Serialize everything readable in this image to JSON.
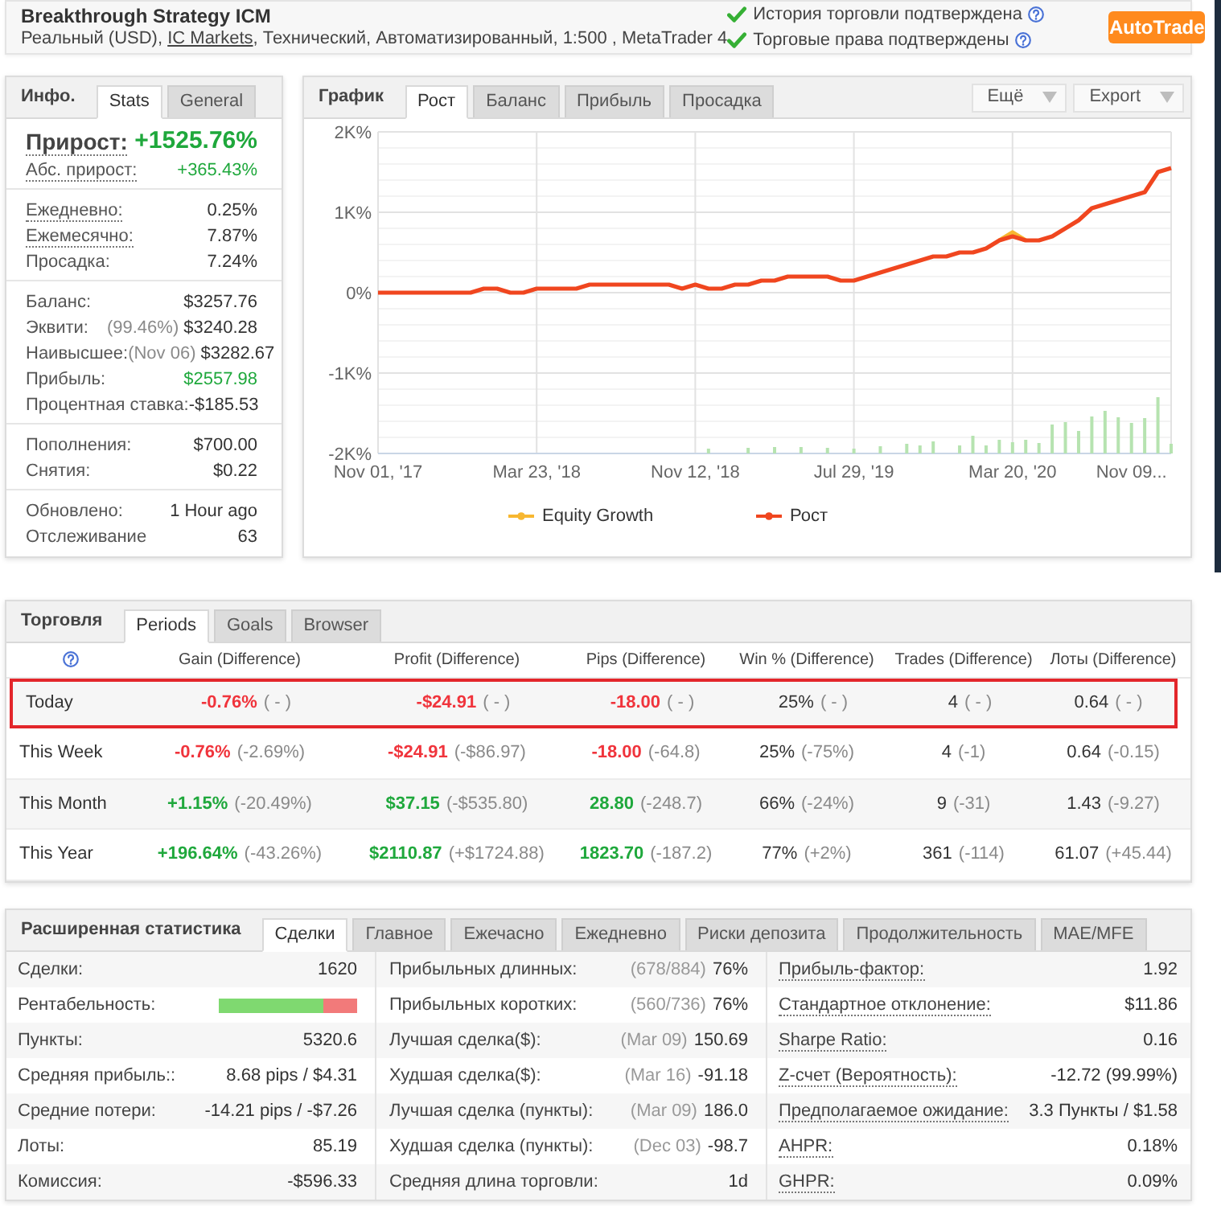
{
  "header": {
    "title": "Breakthrough Strategy ICM",
    "subtitle": [
      {
        "kind": "text",
        "text": "Реальный (USD), "
      },
      {
        "kind": "link",
        "text": "IC Markets"
      },
      {
        "kind": "text",
        "text": ", Технический, Автоматизированный, 1:500 , MetaTrader 4"
      }
    ],
    "verifications": [
      {
        "text": "История торговли подтверждена",
        "verified": true
      },
      {
        "text": "Торговые права подтверждены",
        "verified": true
      }
    ],
    "action_button": "AutoTrade"
  },
  "info_panel": {
    "title": "Инфо.",
    "tabs": [
      {
        "label": "Stats",
        "selected": true
      },
      {
        "label": "General",
        "selected": false
      }
    ],
    "groups": [
      [
        {
          "kind": "headline",
          "label": "Прирост:",
          "value": "+1525.76%",
          "color": "#1fa83c",
          "tooltip": true
        },
        {
          "kind": "text",
          "label": "Абс. прирост:",
          "value": "+365.43%",
          "color": "#1fa83c",
          "tooltip": true
        }
      ],
      [
        {
          "kind": "text",
          "label": "Ежедневно:",
          "value": "0.25%",
          "color": "#333333",
          "tooltip": true
        },
        {
          "kind": "text",
          "label": "Ежемесячно:",
          "value": "7.87%",
          "color": "#333333",
          "tooltip": true
        },
        {
          "kind": "text",
          "label": "Просадка:",
          "value": "7.24%",
          "color": "#333333",
          "tooltip": false
        }
      ],
      [
        {
          "kind": "text",
          "label": "Баланс:",
          "value": "$3257.76",
          "color": "#333333",
          "tooltip": false
        },
        {
          "kind": "text",
          "label": "Эквити:",
          "note": "(99.46%)",
          "value": "$3240.28",
          "color": "#333333",
          "tooltip": false
        },
        {
          "kind": "text",
          "label": "Наивысшее:",
          "note": "(Nov 06)",
          "value": "$3282.67",
          "color": "#333333",
          "tooltip": false
        },
        {
          "kind": "text",
          "label": "Прибыль:",
          "value": "$2557.98",
          "color": "#1fa83c",
          "tooltip": false
        },
        {
          "kind": "text",
          "label": "Процентная ставка:",
          "value": "-$185.53",
          "color": "#333333",
          "tooltip": false
        }
      ],
      [
        {
          "kind": "text",
          "label": "Пополнения:",
          "value": "$700.00",
          "color": "#333333",
          "tooltip": false
        },
        {
          "kind": "text",
          "label": "Снятия:",
          "value": "$0.22",
          "color": "#333333",
          "tooltip": false
        }
      ],
      [
        {
          "kind": "text",
          "label": "Обновлено:",
          "value": "1 Hour ago",
          "color": "#333333",
          "tooltip": false
        },
        {
          "kind": "text",
          "label": "Отслеживание",
          "value": "63",
          "color": "#333333",
          "tooltip": false
        }
      ]
    ]
  },
  "chart_panel": {
    "title": "График",
    "tabs": [
      {
        "label": "Рост",
        "selected": true
      },
      {
        "label": "Баланс",
        "selected": false
      },
      {
        "label": "Прибыль",
        "selected": false
      },
      {
        "label": "Просадка",
        "selected": false
      }
    ],
    "menus": [
      {
        "label": "Ещё"
      },
      {
        "label": "Export"
      }
    ],
    "chart_data": {
      "type": "line",
      "grid": true,
      "categories": [
        "Nov 01, '17",
        null,
        null,
        null,
        null,
        null,
        null,
        null,
        null,
        null,
        null,
        null,
        "Mar 23, '18",
        null,
        null,
        null,
        null,
        null,
        null,
        null,
        null,
        null,
        null,
        null,
        "Nov 12, '18",
        null,
        null,
        null,
        null,
        null,
        null,
        null,
        null,
        null,
        null,
        null,
        "Jul 29, '19",
        null,
        null,
        null,
        null,
        null,
        null,
        null,
        null,
        null,
        null,
        null,
        "Mar 20, '20",
        null,
        null,
        null,
        null,
        null,
        null,
        null,
        null,
        "Nov 09...",
        null,
        null,
        null
      ],
      "ylim": [
        -2000,
        2000
      ],
      "yticks": [
        {
          "value": 2000,
          "label": "2K%"
        },
        {
          "value": 1000,
          "label": "1K%"
        },
        {
          "value": 0,
          "label": "0%"
        },
        {
          "value": -1000,
          "label": "-1K%"
        },
        {
          "value": -2000,
          "label": "-2K%"
        }
      ],
      "series": [
        {
          "name": "Equity Growth",
          "color": "#f7b731",
          "values": [
            null,
            null,
            null,
            null,
            null,
            null,
            null,
            null,
            null,
            null,
            null,
            null,
            null,
            null,
            null,
            null,
            null,
            null,
            null,
            null,
            null,
            null,
            null,
            null,
            null,
            null,
            null,
            null,
            null,
            null,
            null,
            null,
            null,
            null,
            null,
            null,
            null,
            null,
            null,
            null,
            null,
            null,
            null,
            null,
            null,
            null,
            null,
            650,
            750,
            650,
            null,
            null,
            null,
            null,
            null,
            null,
            null,
            null,
            null,
            null,
            null
          ]
        },
        {
          "name": "Рост",
          "color": "#f0461f",
          "values": [
            0,
            0,
            0,
            0,
            0,
            0,
            0,
            0,
            50,
            50,
            0,
            0,
            50,
            50,
            50,
            50,
            100,
            100,
            100,
            100,
            100,
            100,
            100,
            50,
            100,
            50,
            50,
            100,
            100,
            150,
            150,
            200,
            200,
            200,
            200,
            150,
            150,
            200,
            250,
            300,
            350,
            400,
            450,
            450,
            500,
            500,
            550,
            650,
            700,
            650,
            650,
            700,
            800,
            900,
            1050,
            1100,
            1150,
            1200,
            1250,
            1500,
            1550
          ]
        }
      ]
    }
  },
  "trading_panel": {
    "title": "Торговля",
    "tabs": [
      {
        "label": "Periods",
        "selected": true
      },
      {
        "label": "Goals",
        "selected": false
      },
      {
        "label": "Browser",
        "selected": false
      }
    ],
    "columns": [
      "Gain (Difference)",
      "Profit (Difference)",
      "Pips (Difference)",
      "Win % (Difference)",
      "Trades (Difference)",
      "Лоты (Difference)"
    ],
    "rows": [
      {
        "label": "Today",
        "highlighted": true,
        "cells": [
          {
            "value": "-0.76%",
            "diff": "( - )",
            "color": "#f0343c"
          },
          {
            "value": "-$24.91",
            "diff": "( - )",
            "color": "#f0343c"
          },
          {
            "value": "-18.00",
            "diff": "( - )",
            "color": "#f0343c"
          },
          {
            "value": "25%",
            "diff": "( - )",
            "color": "#333333"
          },
          {
            "value": "4",
            "diff": "( - )",
            "color": "#333333"
          },
          {
            "value": "0.64",
            "diff": "( - )",
            "color": "#333333"
          }
        ]
      },
      {
        "label": "This Week",
        "highlighted": false,
        "cells": [
          {
            "value": "-0.76%",
            "diff": "(-2.69%)",
            "color": "#f0343c"
          },
          {
            "value": "-$24.91",
            "diff": "(-$86.97)",
            "color": "#f0343c"
          },
          {
            "value": "-18.00",
            "diff": "(-64.8)",
            "color": "#f0343c"
          },
          {
            "value": "25%",
            "diff": "(-75%)",
            "color": "#333333"
          },
          {
            "value": "4",
            "diff": "(-1)",
            "color": "#333333"
          },
          {
            "value": "0.64",
            "diff": "(-0.15)",
            "color": "#333333"
          }
        ]
      },
      {
        "label": "This Month",
        "highlighted": false,
        "cells": [
          {
            "value": "+1.15%",
            "diff": "(-20.49%)",
            "color": "#1fa83c"
          },
          {
            "value": "$37.15",
            "diff": "(-$535.80)",
            "color": "#1fa83c"
          },
          {
            "value": "28.80",
            "diff": "(-248.7)",
            "color": "#1fa83c"
          },
          {
            "value": "66%",
            "diff": "(-24%)",
            "color": "#333333"
          },
          {
            "value": "9",
            "diff": "(-31)",
            "color": "#333333"
          },
          {
            "value": "1.43",
            "diff": "(-9.27)",
            "color": "#333333"
          }
        ]
      },
      {
        "label": "This Year",
        "highlighted": false,
        "cells": [
          {
            "value": "+196.64%",
            "diff": "(-43.26%)",
            "color": "#1fa83c"
          },
          {
            "value": "$2110.87",
            "diff": "(+$1724.88)",
            "color": "#1fa83c"
          },
          {
            "value": "1823.70",
            "diff": "(-187.2)",
            "color": "#1fa83c"
          },
          {
            "value": "77%",
            "diff": "(+2%)",
            "color": "#333333"
          },
          {
            "value": "361",
            "diff": "(-114)",
            "color": "#333333"
          },
          {
            "value": "61.07",
            "diff": "(+45.44)",
            "color": "#333333"
          }
        ]
      }
    ]
  },
  "extended_stats": {
    "title": "Расширенная статистика",
    "tabs": [
      {
        "label": "Сделки",
        "selected": true
      },
      {
        "label": "Главное",
        "selected": false
      },
      {
        "label": "Ежечасно",
        "selected": false
      },
      {
        "label": "Ежедневно",
        "selected": false
      },
      {
        "label": "Риски депозита",
        "selected": false
      },
      {
        "label": "Продолжительность",
        "selected": false
      },
      {
        "label": "MAE/MFE",
        "selected": false
      }
    ],
    "columns": [
      [
        {
          "kind": "text",
          "label": "Сделки:",
          "value": "1620",
          "tooltip": false
        },
        {
          "kind": "bar",
          "label": "Рентабельность:",
          "level": 0.75,
          "tooltip": false
        },
        {
          "kind": "text",
          "label": "Пункты:",
          "value": "5320.6",
          "tooltip": false
        },
        {
          "kind": "text",
          "label": "Средняя прибыль::",
          "value": "8.68 pips / $4.31",
          "tooltip": false
        },
        {
          "kind": "text",
          "label": "Средние потери:",
          "value": "-14.21 pips / -$7.26",
          "tooltip": false
        },
        {
          "kind": "text",
          "label": "Лоты:",
          "value": "85.19",
          "tooltip": false
        },
        {
          "kind": "text",
          "label": "Комиссия:",
          "value": "-$596.33",
          "tooltip": false
        }
      ],
      [
        {
          "kind": "text",
          "label": "Прибыльных длинных:",
          "note": "(678/884)",
          "value": "76%",
          "tooltip": false
        },
        {
          "kind": "text",
          "label": "Прибыльных коротких:",
          "note": "(560/736)",
          "value": "76%",
          "tooltip": false
        },
        {
          "kind": "text",
          "label": "Лучшая сделка($):",
          "note": "(Mar 09)",
          "value": "150.69",
          "tooltip": false
        },
        {
          "kind": "text",
          "label": "Худшая сделка($):",
          "note": "(Mar 16)",
          "value": "-91.18",
          "tooltip": false
        },
        {
          "kind": "text",
          "label": "Лучшая сделка (пункты):",
          "note": "(Mar 09)",
          "value": "186.0",
          "tooltip": false
        },
        {
          "kind": "text",
          "label": "Худшая сделка (пункты):",
          "note": "(Dec 03)",
          "value": "-98.7",
          "tooltip": false
        },
        {
          "kind": "text",
          "label": "Средняя длина торговли:",
          "value": "1d",
          "tooltip": false
        }
      ],
      [
        {
          "kind": "text",
          "label": "Прибыль-фактор:",
          "value": "1.92",
          "tooltip": true
        },
        {
          "kind": "text",
          "label": "Стандартное отклонение:",
          "value": "$11.86",
          "tooltip": true
        },
        {
          "kind": "text",
          "label": "Sharpe Ratio:",
          "value": "0.16",
          "tooltip": true
        },
        {
          "kind": "text",
          "label": "Z-счет (Вероятность):",
          "value": "-12.72 (99.99%)",
          "tooltip": true
        },
        {
          "kind": "text",
          "label": "Предполагаемое ожидание:",
          "value": "3.3 Пункты / $1.58",
          "tooltip": true
        },
        {
          "kind": "text",
          "label": "AHPR:",
          "value": "0.18%",
          "tooltip": true
        },
        {
          "kind": "text",
          "label": "GHPR:",
          "value": "0.09%",
          "tooltip": true
        }
      ]
    ]
  }
}
